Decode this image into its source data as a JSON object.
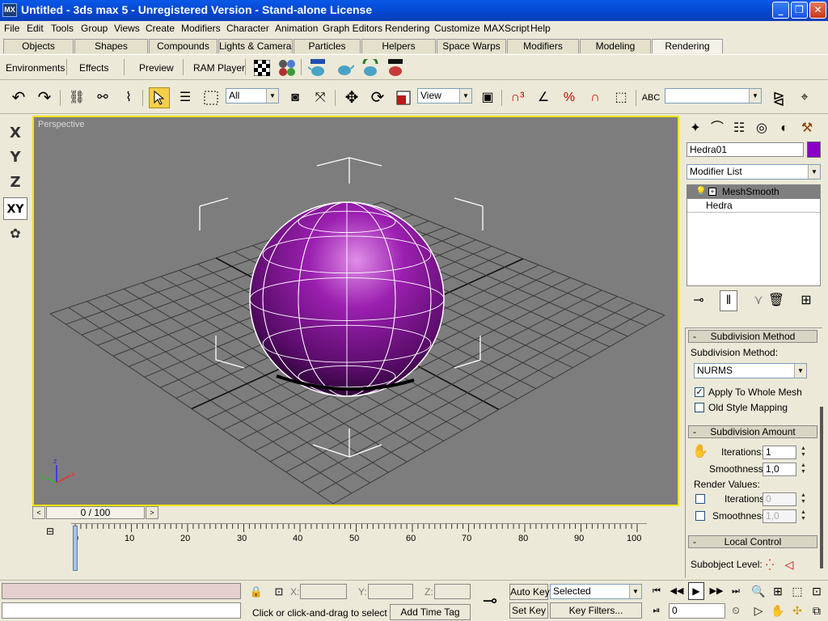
{
  "window": {
    "title": "Untitled - 3ds max 5 - Unregistered Version - Stand-alone License",
    "icon": "max-app-icon"
  },
  "menu": [
    "File",
    "Edit",
    "Tools",
    "Group",
    "Views",
    "Create",
    "Modifiers",
    "Character",
    "Animation",
    "Graph Editors",
    "Rendering",
    "Customize",
    "MAXScript",
    "Help"
  ],
  "tabs": [
    {
      "label": "Objects"
    },
    {
      "label": "Shapes"
    },
    {
      "label": "Compounds"
    },
    {
      "label": "Lights & Cameras"
    },
    {
      "label": "Particles"
    },
    {
      "label": "Helpers"
    },
    {
      "label": "Space Warps"
    },
    {
      "label": "Modifiers"
    },
    {
      "label": "Modeling"
    },
    {
      "label": "Rendering"
    }
  ],
  "active_tab": "Rendering",
  "render_tab": {
    "environments": "Environments",
    "effects": "Effects",
    "preview": "Preview",
    "ram_player": "RAM Player"
  },
  "main_toolbar": {
    "selection_filter": "All",
    "ref_coord": "View",
    "named_selection": ""
  },
  "axis_constraints": [
    "X",
    "Y",
    "Z",
    "XY"
  ],
  "viewport": {
    "label": "Perspective",
    "object_color": "#9B1FB0",
    "border_color": "#F0E400"
  },
  "command_panel": {
    "object_name": "Hedra01",
    "object_color": "#8B00C8",
    "modifier_list": "Modifier List",
    "stack": [
      {
        "name": "MeshSmooth",
        "selected": true
      },
      {
        "name": "Hedra",
        "selected": false
      }
    ],
    "subdivision_method": {
      "header": "Subdivision Method",
      "label": "Subdivision Method:",
      "value": "NURMS",
      "apply_whole_mesh": {
        "label": "Apply To Whole Mesh",
        "checked": true
      },
      "old_style_mapping": {
        "label": "Old Style Mapping",
        "checked": false
      }
    },
    "subdivision_amount": {
      "header": "Subdivision Amount",
      "iterations_label": "Iterations:",
      "iterations": "1",
      "smoothness_label": "Smoothness:",
      "smoothness": "1,0",
      "render_values_label": "Render Values:",
      "render_iterations_label": "Iterations:",
      "render_iterations": "0",
      "render_smoothness_label": "Smoothness:",
      "render_smoothness": "1,0"
    },
    "local_control": {
      "header": "Local Control",
      "subobject_label": "Subobject Level:"
    }
  },
  "timeline": {
    "frame": "0 / 100",
    "ticks": [
      "0",
      "10",
      "20",
      "30",
      "40",
      "50",
      "60",
      "70",
      "80",
      "90",
      "100"
    ]
  },
  "status": {
    "x_label": "X:",
    "y_label": "Y:",
    "z_label": "Z:",
    "x": "",
    "y": "",
    "z": "",
    "prompt": "Click or click-and-drag to select obj",
    "add_time_tag": "Add Time Tag",
    "auto_key": "Auto Key",
    "set_key": "Set Key",
    "selected": "Selected",
    "key_filters": "Key Filters...",
    "current_frame": "0"
  }
}
